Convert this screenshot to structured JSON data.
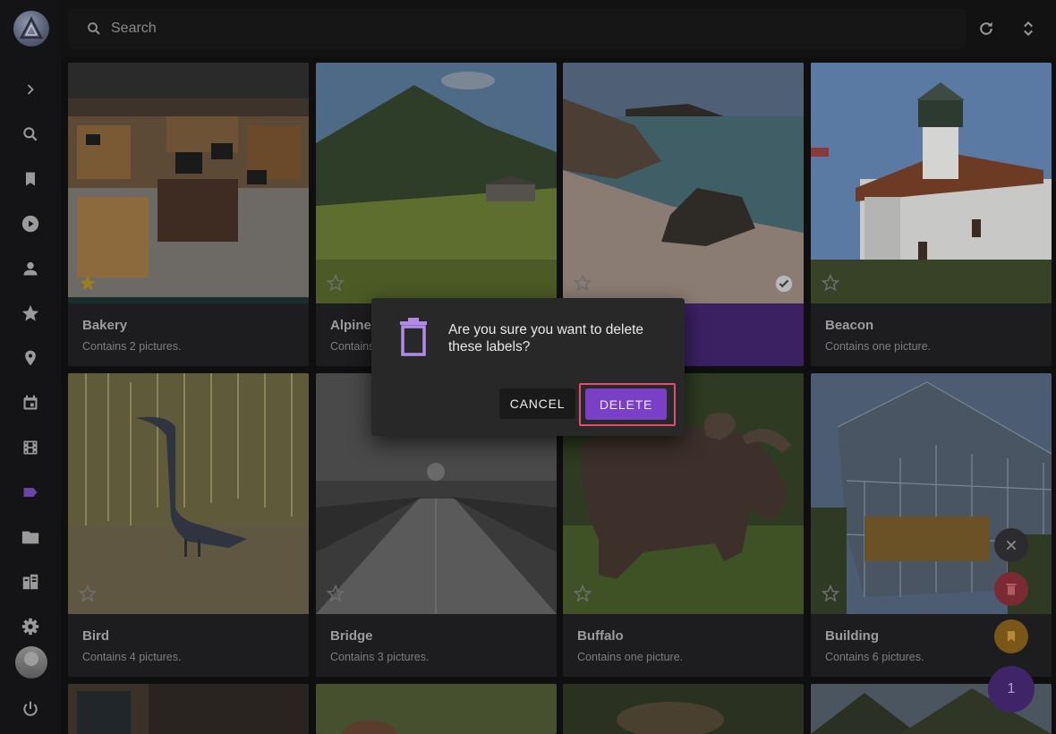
{
  "search": {
    "placeholder": "Search"
  },
  "sidebar": {
    "items": [
      {
        "icon": "chevron-right-icon"
      },
      {
        "icon": "search-icon"
      },
      {
        "icon": "bookmark-icon"
      },
      {
        "icon": "play-circle-icon"
      },
      {
        "icon": "person-icon"
      },
      {
        "icon": "star-icon"
      },
      {
        "icon": "location-pin-icon"
      },
      {
        "icon": "calendar-icon"
      },
      {
        "icon": "film-icon"
      },
      {
        "icon": "label-icon",
        "active": true
      },
      {
        "icon": "folder-icon"
      },
      {
        "icon": "library-icon"
      },
      {
        "icon": "gear-icon"
      },
      {
        "icon": "power-icon"
      }
    ],
    "active_color": "#6a44a6"
  },
  "labels": [
    {
      "title": "Bakery",
      "subtitle": "Contains 2 pictures.",
      "favorite": true
    },
    {
      "title": "Alpine",
      "subtitle": "Contains",
      "favorite": false
    },
    {
      "title": "",
      "subtitle": "",
      "favorite": false,
      "selected": true
    },
    {
      "title": "Beacon",
      "subtitle": "Contains one picture.",
      "favorite": false
    },
    {
      "title": "Bird",
      "subtitle": "Contains 4 pictures.",
      "favorite": false
    },
    {
      "title": "Bridge",
      "subtitle": "Contains 3 pictures.",
      "favorite": false
    },
    {
      "title": "Buffalo",
      "subtitle": "Contains one picture.",
      "favorite": false
    },
    {
      "title": "Building",
      "subtitle": "Contains 6 pictures.",
      "favorite": false
    }
  ],
  "dialog": {
    "message": "Are you sure you want to delete these labels?",
    "cancel_label": "CANCEL",
    "delete_label": "DELETE"
  },
  "fab": {
    "selection_count": "1"
  },
  "colors": {
    "accent": "#7a3fc7",
    "favorite": "#c9a227",
    "danger": "#c0392b",
    "highlight": "#e24c6e"
  }
}
